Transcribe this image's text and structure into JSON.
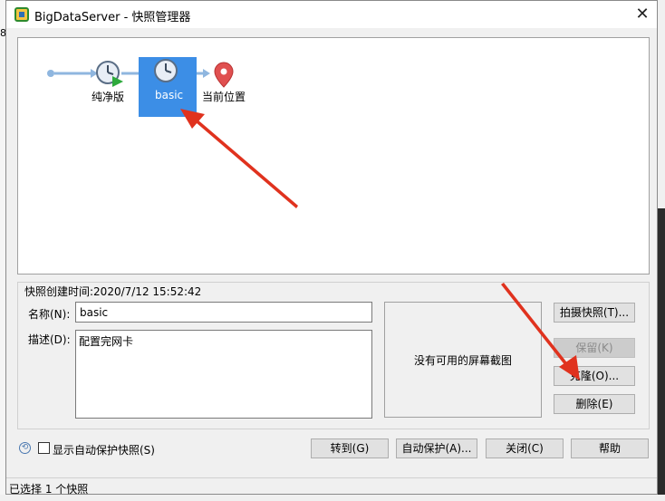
{
  "window": {
    "title": "BigDataServer - 快照管理器",
    "close_glyph": "✕"
  },
  "background": {
    "left_char": "8"
  },
  "snapshot_tree": {
    "nodes": [
      {
        "id": "pure",
        "label": "纯净版"
      },
      {
        "id": "basic",
        "label": "basic",
        "selected": true
      },
      {
        "id": "current",
        "label": "当前位置"
      }
    ]
  },
  "details": {
    "created_time": "快照创建时间:2020/7/12 15:52:42",
    "name_label": "名称(N):",
    "name_value": "basic",
    "desc_label": "描述(D):",
    "desc_value": "配置完网卡",
    "preview_text": "没有可用的屏幕截图"
  },
  "side_buttons": {
    "take_snapshot": "拍摄快照(T)...",
    "keep": "保留(K)",
    "clone": "克隆(O)...",
    "delete": "删除(E)"
  },
  "bottom": {
    "show_autoprotect": "显示自动保护快照(S)",
    "goto": "转到(G)",
    "autoprotect": "自动保护(A)...",
    "close": "关闭(C)",
    "help": "帮助"
  },
  "status": {
    "text": "已选择 1 个快照"
  },
  "colors": {
    "selection": "#3c8ee6",
    "arrow": "#e0321e",
    "connector": "#8fb6df"
  },
  "icons": [
    "app-icon",
    "clock-icon",
    "play-icon",
    "location-pin-icon",
    "autoprotect-icon",
    "close-icon"
  ]
}
